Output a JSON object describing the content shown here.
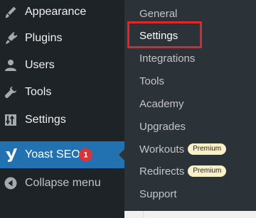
{
  "menu": {
    "items": [
      {
        "label": "Appearance",
        "icon": "paintbrush-icon"
      },
      {
        "label": "Plugins",
        "icon": "plugin-icon"
      },
      {
        "label": "Users",
        "icon": "users-icon"
      },
      {
        "label": "Tools",
        "icon": "wrench-icon"
      },
      {
        "label": "Settings",
        "icon": "settings-icon"
      },
      {
        "label": "Yoast SEO",
        "icon": "yoast-icon",
        "badge": "1"
      },
      {
        "label": "Collapse menu",
        "icon": "collapse-icon"
      }
    ]
  },
  "submenu": {
    "items": [
      {
        "label": "General"
      },
      {
        "label": "Settings"
      },
      {
        "label": "Integrations"
      },
      {
        "label": "Tools"
      },
      {
        "label": "Academy"
      },
      {
        "label": "Upgrades"
      },
      {
        "label": "Workouts",
        "badge": "Premium"
      },
      {
        "label": "Redirects",
        "badge": "Premium"
      },
      {
        "label": "Support"
      }
    ],
    "highlighted": "Settings"
  },
  "colors": {
    "menu_bg": "#1d2327",
    "submenu_bg": "#2c3338",
    "active_bg": "#2271b1",
    "badge_red": "#d63638",
    "premium_bg": "#fcf0c6",
    "highlight_border": "#e0262a"
  }
}
